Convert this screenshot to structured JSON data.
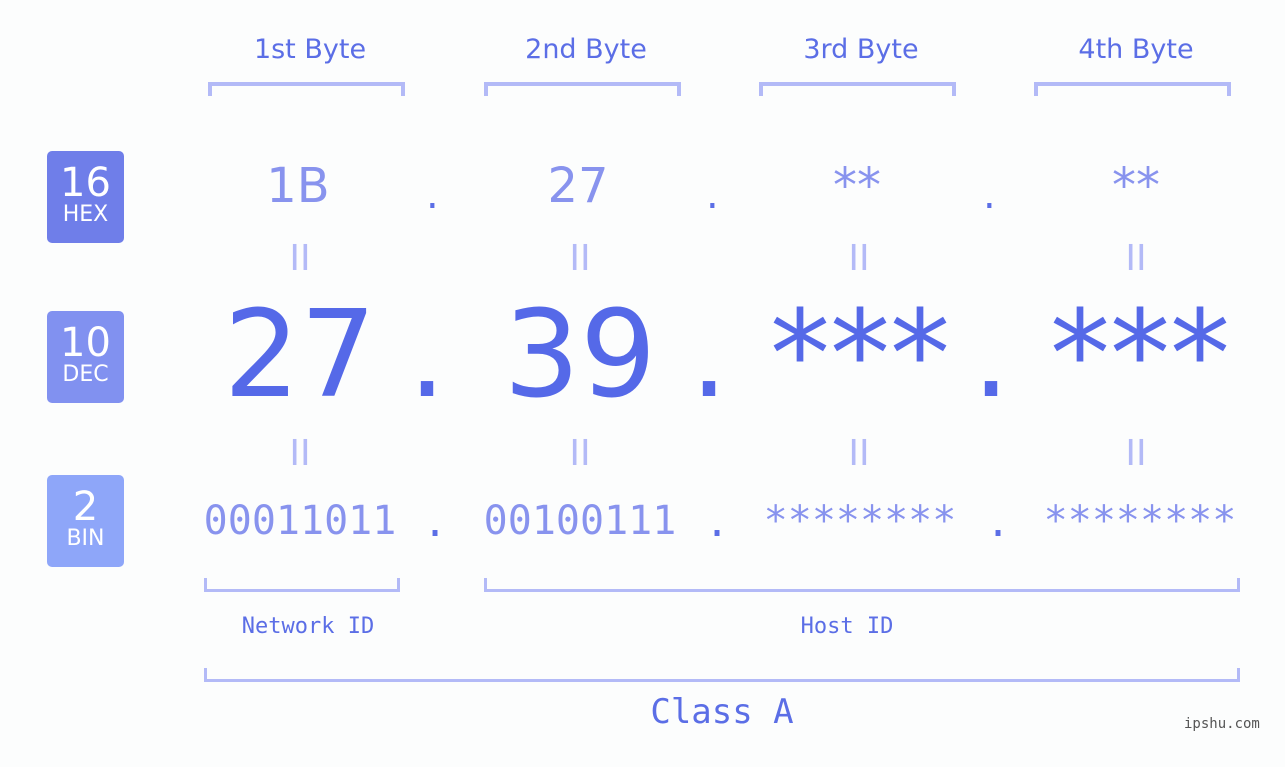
{
  "bytes": {
    "headers": [
      "1st Byte",
      "2nd Byte",
      "3rd Byte",
      "4th Byte"
    ]
  },
  "badges": [
    {
      "num": "16",
      "label": "HEX",
      "color": "#6f7ee9"
    },
    {
      "num": "10",
      "label": "DEC",
      "color": "#8191f0"
    },
    {
      "num": "2",
      "label": "BIN",
      "color": "#8ea6f9"
    }
  ],
  "hex": [
    "1B",
    "27",
    "**",
    "**"
  ],
  "dec": [
    "27",
    "39",
    "***",
    "***"
  ],
  "bin": [
    "00011011",
    "00100111",
    "********",
    "********"
  ],
  "separator": ".",
  "equals": "II",
  "groups": {
    "network": "Network ID",
    "host": "Host ID",
    "class": "Class A"
  },
  "watermark": "ipshu.com"
}
